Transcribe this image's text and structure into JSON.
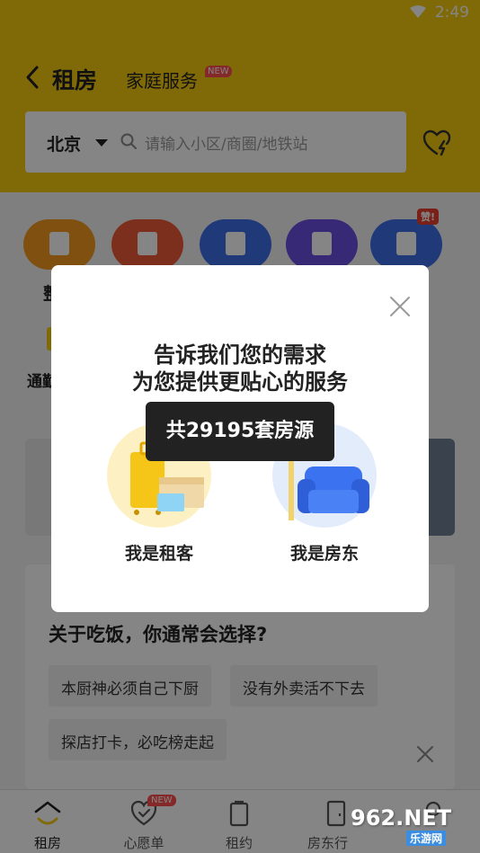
{
  "status_bar": {
    "time": "2:49"
  },
  "header": {
    "title": "租房",
    "tab_service": "家庭服务",
    "new_tag": "NEW",
    "city": "北京",
    "search_placeholder": "请输入小区/商圈/地铁站"
  },
  "categories": {
    "badge": "赞!",
    "partial_label": "整",
    "second_row_label": "通勤"
  },
  "survey": {
    "question": "关于吃饭，你通常会选择?",
    "options": [
      "本厨神必须自己下厨",
      "没有外卖活不下去",
      "探店打卡，必吃榜走起"
    ]
  },
  "modal": {
    "title_line1": "告诉我们您的需求",
    "title_line2": "为您提供更贴心的服务",
    "count_text": "共29195套房源",
    "tenant_label": "我是租客",
    "landlord_label": "我是房东"
  },
  "bottom_nav": {
    "items": [
      {
        "label": "租房",
        "icon": "home-roof-icon"
      },
      {
        "label": "心愿单",
        "icon": "heart-check-icon"
      },
      {
        "label": "租约",
        "icon": "document-icon"
      },
      {
        "label": "房东行",
        "icon": "door-icon"
      },
      {
        "label": "",
        "icon": "profile-icon"
      }
    ],
    "new_tag": "NEW"
  },
  "watermark": {
    "main": "962.NET",
    "sub": "乐游网"
  },
  "colors": {
    "brand_yellow": "#f5cb10",
    "new_red": "#ff4d4f",
    "dark_pill": "#222222"
  }
}
